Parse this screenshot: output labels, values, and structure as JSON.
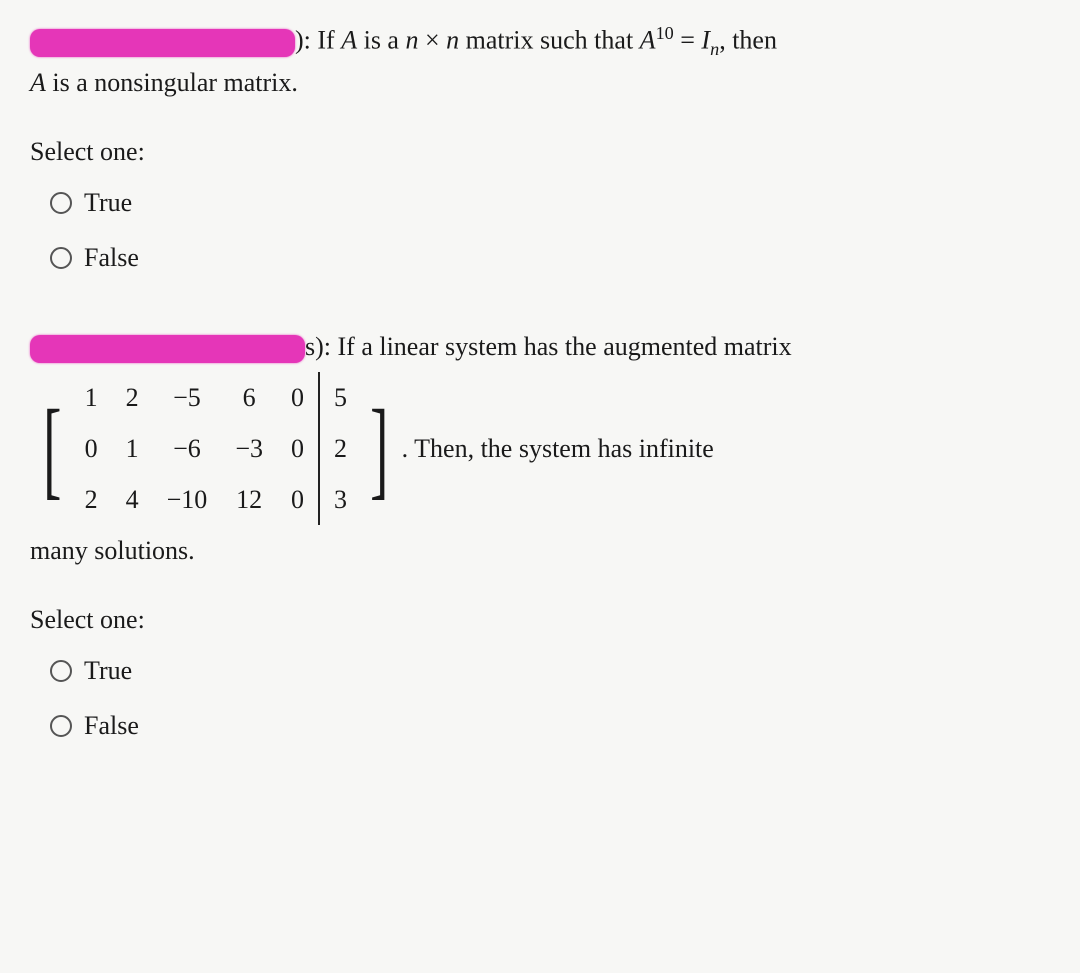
{
  "q1": {
    "text_part1": "): If ",
    "var_A": "A",
    "text_part2": " is a ",
    "var_n1": "n",
    "times": " × ",
    "var_n2": "n",
    "text_part3": " matrix such that ",
    "var_A2": "A",
    "exp": "10",
    "eq": " = ",
    "var_I": "I",
    "sub_n": "n",
    "text_part4": ", then ",
    "line2_A": "A",
    "line2_text": " is a nonsingular matrix.",
    "select_label": "Select one:",
    "opt_true": "True",
    "opt_false": "False"
  },
  "q2": {
    "text_part1": "s): If a linear system has the augmented matrix",
    "text_after_matrix": ". Then, the system has infinite ",
    "text_line3": "many solutions.",
    "select_label": "Select one:",
    "opt_true": "True",
    "opt_false": "False",
    "matrix": {
      "r1": {
        "c1": "1",
        "c2": "2",
        "c3": "−5",
        "c4": "6",
        "c5": "0",
        "c6": "5"
      },
      "r2": {
        "c1": "0",
        "c2": "1",
        "c3": "−6",
        "c4": "−3",
        "c5": "0",
        "c6": "2"
      },
      "r3": {
        "c1": "2",
        "c2": "4",
        "c3": "−10",
        "c4": "12",
        "c5": "0",
        "c6": "3"
      }
    }
  }
}
